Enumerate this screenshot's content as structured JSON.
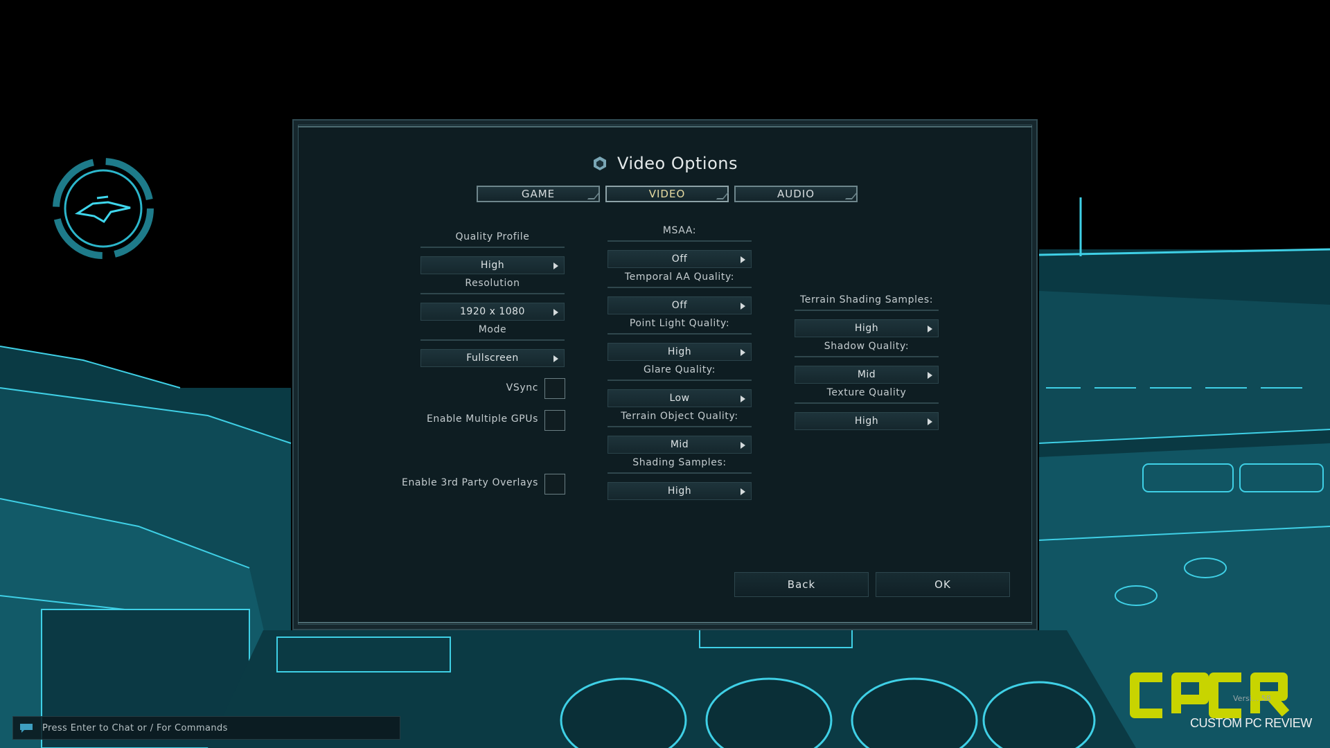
{
  "window": {
    "title": "Video Options"
  },
  "tabs": [
    {
      "label": "GAME",
      "active": false
    },
    {
      "label": "VIDEO",
      "active": true
    },
    {
      "label": "AUDIO",
      "active": false
    }
  ],
  "left_column": {
    "quality_profile": {
      "label": "Quality Profile",
      "value": "High"
    },
    "resolution": {
      "label": "Resolution",
      "value": "1920 x 1080"
    },
    "mode": {
      "label": "Mode",
      "value": "Fullscreen"
    },
    "vsync": {
      "label": "VSync",
      "checked": false
    },
    "multi_gpu": {
      "label": "Enable Multiple GPUs",
      "checked": false
    },
    "overlays": {
      "label": "Enable 3rd Party Overlays",
      "checked": false
    }
  },
  "middle_column": {
    "msaa": {
      "label": "MSAA:",
      "value": "Off"
    },
    "temporal_aa": {
      "label": "Temporal AA Quality:",
      "value": "Off"
    },
    "point_light": {
      "label": "Point Light Quality:",
      "value": "High"
    },
    "glare": {
      "label": "Glare Quality:",
      "value": "Low"
    },
    "terrain_object": {
      "label": "Terrain Object Quality:",
      "value": "Mid"
    },
    "shading_samples": {
      "label": "Shading Samples:",
      "value": "High"
    }
  },
  "right_column": {
    "terrain_shading": {
      "label": "Terrain Shading Samples:",
      "value": "High"
    },
    "shadow": {
      "label": "Shadow Quality:",
      "value": "Mid"
    },
    "texture": {
      "label": "Texture Quality",
      "value": "High"
    }
  },
  "buttons": {
    "back": "Back",
    "ok": "OK"
  },
  "chat": {
    "prompt": "Press Enter to Chat or / For Commands"
  },
  "watermark": {
    "brand": "cpcr",
    "subtitle": "CUSTOM PC REVIEW",
    "version": "Versi... 58"
  },
  "colors": {
    "accent_cyan": "#2fc8e0",
    "active_tab_text": "#e8dca2",
    "dialog_bg": "#102228",
    "logo_green": "#c8d400"
  },
  "icons": {
    "title": "hexagon-emblem-icon",
    "dropdown": "triangle-right-icon",
    "chat": "chat-bubble-icon",
    "hud": "ship-icon"
  }
}
